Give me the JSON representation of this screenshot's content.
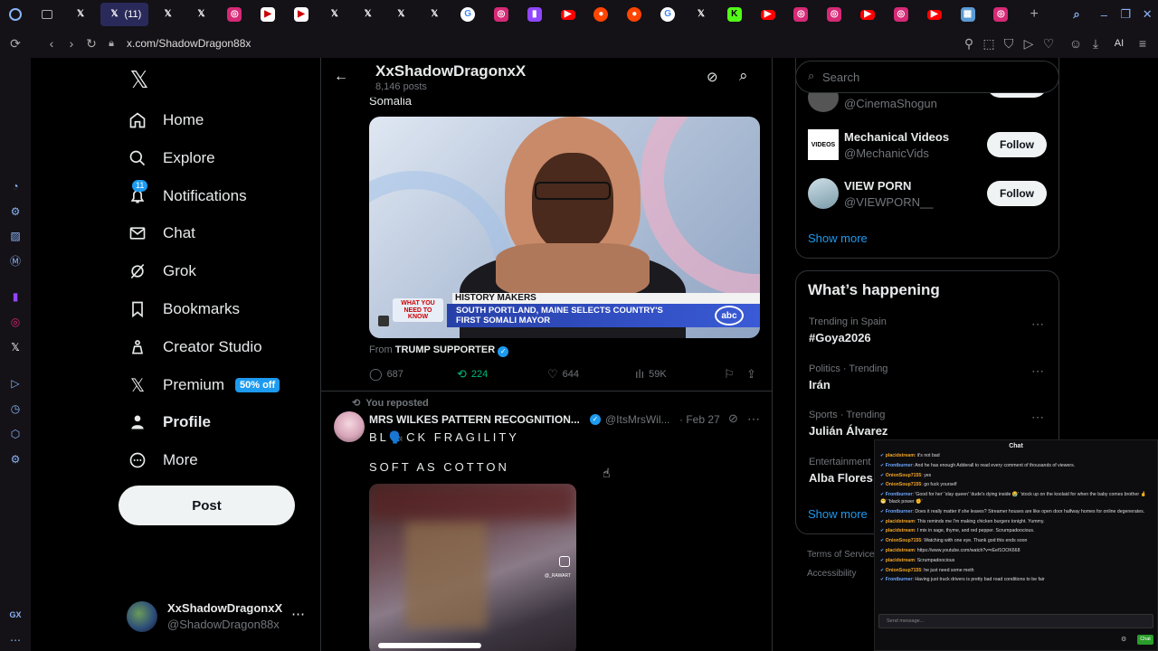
{
  "browser": {
    "tab_count_label": "(11)",
    "tabs": [
      "gx",
      "x",
      "x-active",
      "x",
      "x",
      "instagram",
      "youtube-play",
      "youtube-play",
      "x",
      "x",
      "x",
      "x",
      "google",
      "instagram",
      "twitch",
      "youtube",
      "reddit",
      "reddit",
      "google",
      "x",
      "kick",
      "youtube",
      "instagram",
      "instagram",
      "youtube",
      "instagram",
      "youtube",
      "gx-store",
      "instagram",
      "add"
    ],
    "url": "x.com/ShadowDragon88x",
    "ai_label": "AI"
  },
  "nav": {
    "items": [
      {
        "label": "Home",
        "icon": "home-icon"
      },
      {
        "label": "Explore",
        "icon": "search-icon"
      },
      {
        "label": "Notifications",
        "icon": "bell-icon",
        "badge": "11"
      },
      {
        "label": "Chat",
        "icon": "mail-icon"
      },
      {
        "label": "Grok",
        "icon": "grok-icon"
      },
      {
        "label": "Bookmarks",
        "icon": "bookmark-icon"
      },
      {
        "label": "Creator Studio",
        "icon": "creator-icon"
      },
      {
        "label": "Premium",
        "icon": "x-icon",
        "badge": "50% off"
      },
      {
        "label": "Profile",
        "icon": "person-icon"
      },
      {
        "label": "More",
        "icon": "more-circle-icon"
      }
    ],
    "post_label": "Post",
    "account": {
      "name": "XxShadowDragonxX",
      "handle": "@ShadowDragon88x"
    }
  },
  "header": {
    "name": "XxShadowDragonxX",
    "posts": "8,146 posts"
  },
  "post1": {
    "text_fragment": "Somalia",
    "media": {
      "chyron_tag": "WHAT YOU NEED TO KNOW",
      "chyron_kicker": "HISTORY MAKERS",
      "chyron_line1": "SOUTH PORTLAND, MAINE SELECTS COUNTRY'S",
      "chyron_line2": "FIRST SOMALI MAYOR",
      "network": "abc"
    },
    "from_label": "From",
    "from_name": "TRUMP SUPPORTER",
    "stats": {
      "replies": "687",
      "reposts": "224",
      "likes": "644",
      "views": "59K"
    }
  },
  "post2": {
    "repost_label": "You reposted",
    "name": "MRS WILKES PATTERN RECOGNITION...",
    "handle": "@ItsMrsWil...",
    "date": "· Feb 27",
    "line1": "BL🗣️CK FRAGILITY",
    "line2": "SOFT AS COTTON",
    "media_watermark": "@_RAWART"
  },
  "right": {
    "search_placeholder": "Search",
    "who_to_follow": [
      {
        "name": "",
        "handle": "@CinemaShogun",
        "btn": "Follow"
      },
      {
        "name": "Mechanical Videos",
        "handle": "@MechanicVids",
        "btn": "Follow"
      },
      {
        "name": "VIEW PORN",
        "handle": "@VIEWPORN__",
        "btn": "Follow"
      }
    ],
    "show_more": "Show more",
    "whats_happening": "What’s happening",
    "trends": [
      {
        "meta": "Trending in Spain",
        "title": "#Goya2026"
      },
      {
        "meta": "Politics · Trending",
        "title": "Irán"
      },
      {
        "meta": "Sports · Trending",
        "title": "Julián Álvarez"
      },
      {
        "meta": "Entertainment",
        "title": "Alba Flores"
      }
    ],
    "show_more2": "Show more",
    "footer1": "Terms of Service",
    "footer2": "Accessibility"
  },
  "chat": {
    "title": "Chat",
    "messages": [
      {
        "user": "placidstream",
        "text": "it's not bad",
        "vip": false
      },
      {
        "user": "Frontburner",
        "text": "And he has enough Adderall to read every comment of thousands of viewers.",
        "vip": true
      },
      {
        "user": "OnionSoup7155",
        "text": "yes",
        "vip": false
      },
      {
        "user": "OnionSoup7155",
        "text": "go fuck yourself",
        "vip": false
      },
      {
        "user": "Frontburner",
        "text": "'Good for her' 'slay queen' 'dude's dying inside 😭' 'stock up on the koolaid for when the baby comes brother 🤞😁' 'black power ✊'",
        "vip": true
      },
      {
        "user": "Frontburner",
        "text": "Does it really matter if she leaves? Streamer houses are like open door halfway homes for online degenerates.",
        "vip": true
      },
      {
        "user": "placidstream",
        "text": "This reminds me I'm making chicken burgers tonight. Yummy.",
        "vip": false
      },
      {
        "user": "placidstream",
        "text": "I mix in sage, thyme, and red pepper. Scrumpadoocious.",
        "vip": false
      },
      {
        "user": "OnionSoup7155",
        "text": "Watching with one eye. Thank god this ends soon",
        "vip": false
      },
      {
        "user": "placidstream",
        "text": "https://www.youtube.com/watch?v=rEef1OOK668",
        "vip": false
      },
      {
        "user": "placidstream",
        "text": "Scrumpadoocious",
        "vip": false
      },
      {
        "user": "OnionSoup7155",
        "text": "he just need some meth",
        "vip": false
      },
      {
        "user": "Frontburner",
        "text": "Having just truck drivers is pretty bad road conditions to be fair",
        "vip": true
      }
    ],
    "input_placeholder": "Send message...",
    "send_label": "Chat"
  },
  "colors": {
    "accent": "#1d9bf0",
    "repost_green": "#00ba7c",
    "bg": "#000000",
    "border": "#2f3336"
  }
}
